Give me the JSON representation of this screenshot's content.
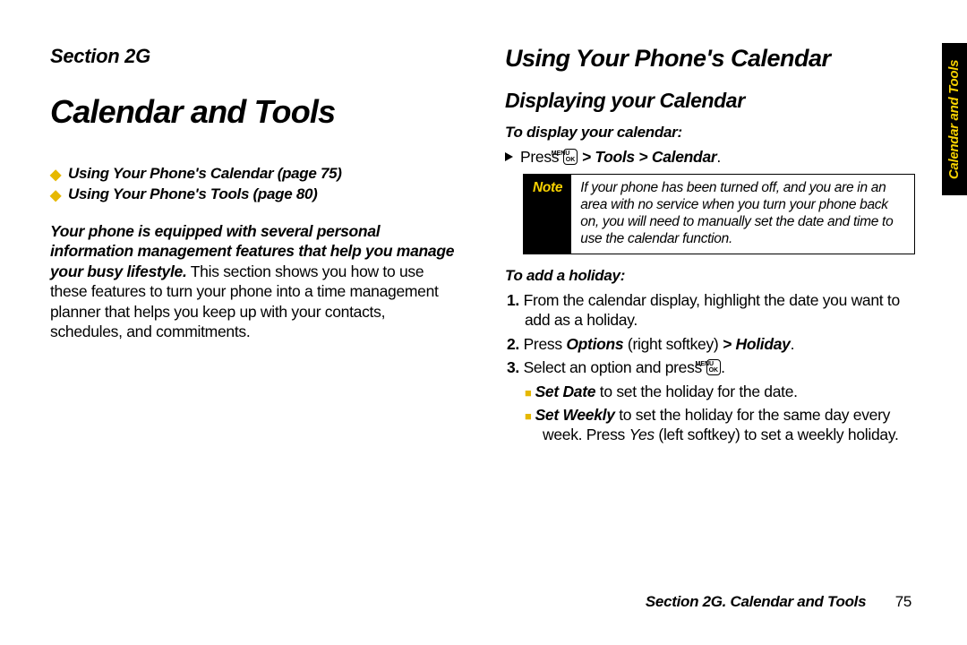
{
  "left": {
    "section_label": "Section 2G",
    "title": "Calendar and Tools",
    "toc": [
      "Using Your Phone's Calendar (page 75)",
      "Using Your Phone's Tools (page 80)"
    ],
    "intro_lead": "Your phone is equipped with several personal information management features that help you manage your busy lifestyle.",
    "intro_rest": " This section shows you how to use these features to turn your phone into a time management planner that helps you keep up with your contacts, schedules, and commitments."
  },
  "right": {
    "h2": "Using Your Phone's Calendar",
    "h3": "Displaying your Calendar",
    "sub1": "To display your calendar:",
    "press_line_prefix": "Press ",
    "press_line_path": " > Tools > Calendar",
    "note_label": "Note",
    "note_text": "If your phone has been turned off, and you are in an area with no service when you turn your phone back on, you will need to manually set the date and time to use the calendar function.",
    "sub2": "To add a holiday:",
    "step1": "From the calendar display, highlight the date you want to add as a holiday.",
    "step2_pre": "Press ",
    "step2_opt": "Options",
    "step2_mid": " (right softkey) ",
    "step2_path": "> Holiday",
    "step3_pre": "Select an option and press ",
    "step3a_bold": "Set Date",
    "step3a_rest": " to set the holiday for the date.",
    "step3b_bold": "Set Weekly",
    "step3b_rest_a": " to set the holiday for the same day every week. Press ",
    "step3b_yes": "Yes",
    "step3b_rest_b": " (left softkey) to set a weekly holiday."
  },
  "key_label_top": "MENU",
  "key_label_bot": "OK",
  "tab_text": "Calendar and Tools",
  "footer_text": "Section 2G. Calendar and Tools",
  "page_number": "75"
}
